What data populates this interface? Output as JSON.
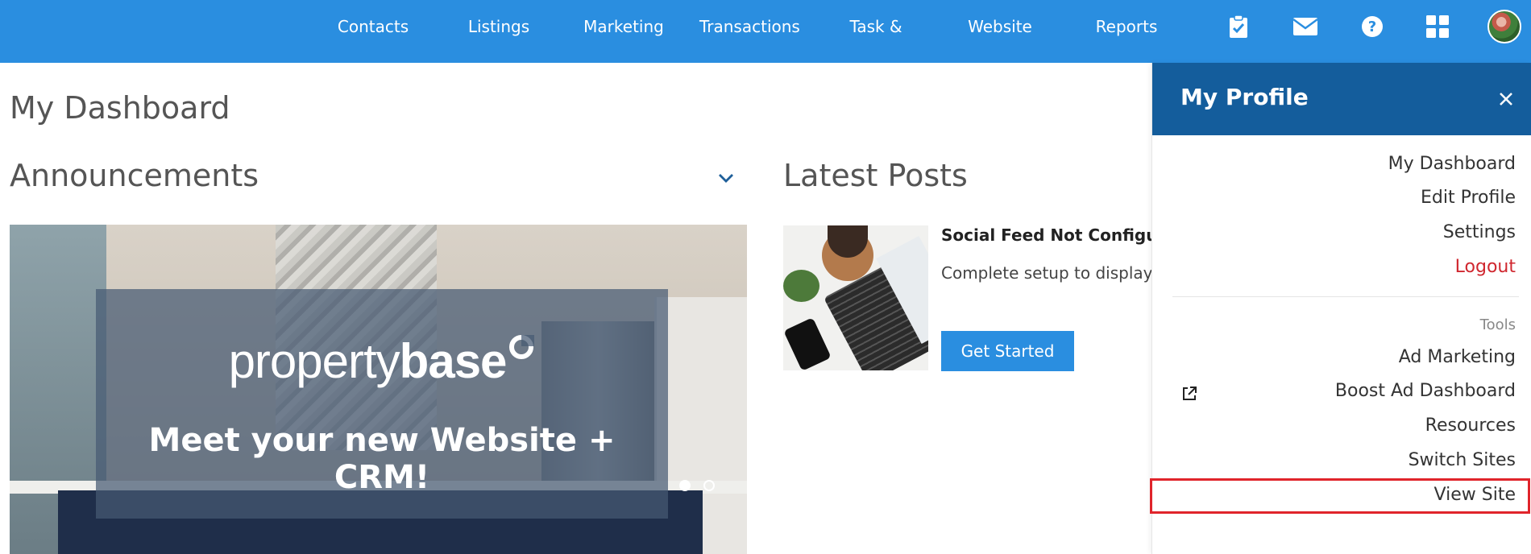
{
  "nav": {
    "items": [
      {
        "label": "Contacts"
      },
      {
        "label": "Listings"
      },
      {
        "label": "Marketing"
      },
      {
        "label": "Transactions"
      },
      {
        "label": "Task & Events"
      },
      {
        "label": "Website"
      },
      {
        "label": "Reports"
      }
    ],
    "icons": [
      "clipboard-check-icon",
      "mail-icon",
      "help-icon",
      "apps-grid-icon"
    ]
  },
  "main": {
    "page_title": "My Dashboard",
    "announcements_title": "Announcements",
    "latest_posts_title": "Latest Posts",
    "banner": {
      "logo_light": "property",
      "logo_bold": "base",
      "tagline": "Meet your new Website + CRM!",
      "slide_count": 2,
      "active_slide": 1
    },
    "post": {
      "title": "Social Feed Not Configured",
      "text": "Complete setup to display",
      "button": "Get Started"
    }
  },
  "profile_panel": {
    "title": "My Profile",
    "items": [
      {
        "label": "My Dashboard"
      },
      {
        "label": "Edit Profile"
      },
      {
        "label": "Settings"
      },
      {
        "label": "Logout"
      }
    ],
    "tools_label": "Tools",
    "tools": [
      {
        "label": "Ad Marketing"
      },
      {
        "label": "Boost Ad Dashboard"
      },
      {
        "label": "Resources"
      },
      {
        "label": "Switch Sites"
      },
      {
        "label": "View Site"
      }
    ]
  },
  "colors": {
    "topbar": "#2a8ee0",
    "panel_header": "#145d9c",
    "logout": "#d0272f",
    "highlight": "#e0242b"
  }
}
